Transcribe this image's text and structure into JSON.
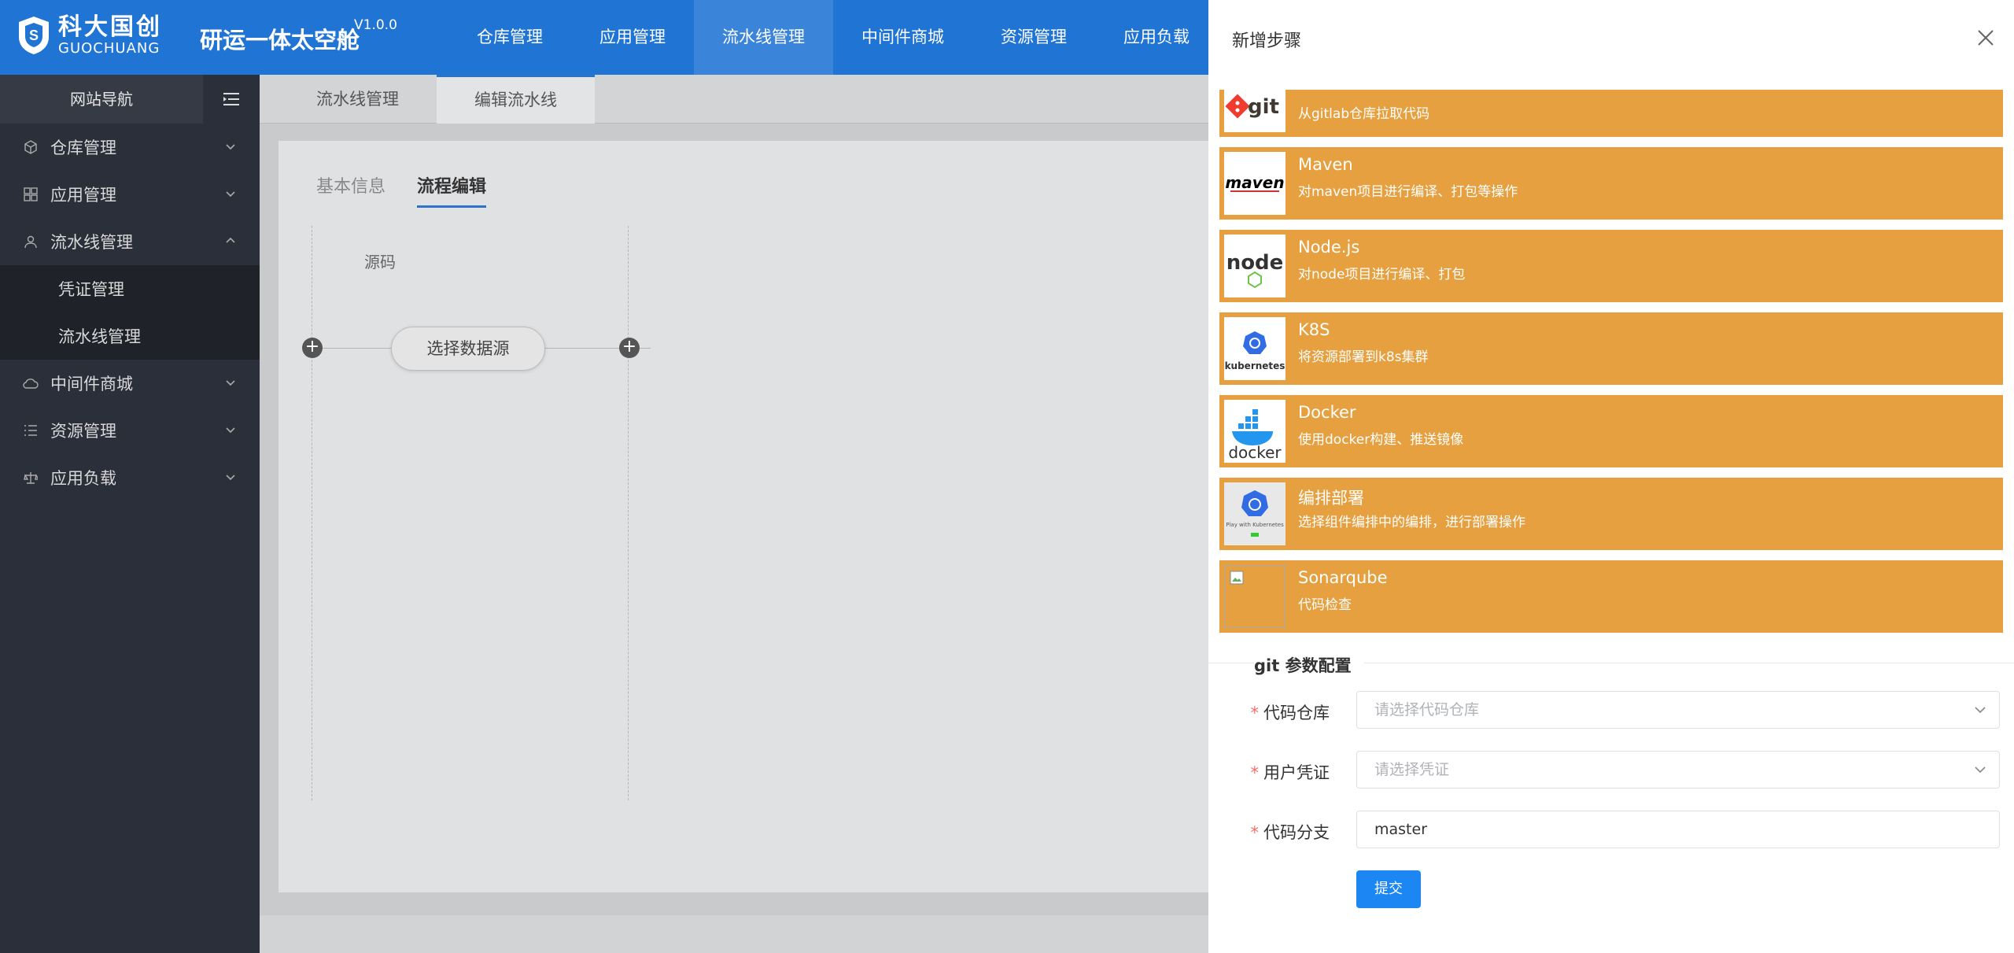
{
  "header": {
    "logo_cn": "科大国创",
    "logo_en": "GUOCHUANG",
    "app_title": "研运一体太空舱",
    "version": "V1.0.0",
    "nav": [
      "仓库管理",
      "应用管理",
      "流水线管理",
      "中间件商城",
      "资源管理",
      "应用负载"
    ],
    "active_nav": "流水线管理"
  },
  "sidebar": {
    "title": "网站导航",
    "items": [
      {
        "label": "仓库管理",
        "icon": "box-icon"
      },
      {
        "label": "应用管理",
        "icon": "grid-icon"
      },
      {
        "label": "流水线管理",
        "icon": "user-group-icon",
        "open": true
      },
      {
        "label": "中间件商城",
        "icon": "cloud-icon"
      },
      {
        "label": "资源管理",
        "icon": "list-icon"
      },
      {
        "label": "应用负载",
        "icon": "balance-icon"
      }
    ],
    "subitems": [
      "凭证管理",
      "流水线管理"
    ]
  },
  "main": {
    "tabs": [
      "流水线管理",
      "编辑流水线"
    ],
    "subtabs": [
      "基本信息",
      "流程编辑"
    ],
    "flow_label": "源码",
    "flow_node": "选择数据源"
  },
  "drawer": {
    "title": "新增步骤",
    "steps": [
      {
        "name": "",
        "desc": "从gitlab仓库拉取代码",
        "logo": "git-logo"
      },
      {
        "name": "Maven",
        "desc": "对maven项目进行编译、打包等操作",
        "logo": "maven-logo"
      },
      {
        "name": "Node.js",
        "desc": "对node项目进行编译、打包",
        "logo": "nodejs-logo"
      },
      {
        "name": "K8S",
        "desc": "将资源部署到k8s集群",
        "logo": "kubernetes-logo"
      },
      {
        "name": "Docker",
        "desc": "使用docker构建、推送镜像",
        "logo": "docker-logo"
      },
      {
        "name": "编排部署",
        "desc": "选择组件编排中的编排，进行部署操作",
        "logo": "play-with-kubernetes-logo"
      },
      {
        "name": "Sonarqube",
        "desc": "代码检查",
        "logo": "broken-image-icon"
      }
    ],
    "logo_text": {
      "git": "git",
      "maven": "maven",
      "node": "node",
      "kubernetes": "kubernetes",
      "docker": "docker",
      "pwk": "Play with Kubernetes"
    },
    "section_title": "git 参数配置",
    "form": {
      "repo_label": "代码仓库",
      "repo_placeholder": "请选择代码仓库",
      "cred_label": "用户凭证",
      "cred_placeholder": "请选择凭证",
      "branch_label": "代码分支",
      "branch_value": "master",
      "submit": "提交"
    }
  },
  "colors": {
    "topbar": "#1f74d4",
    "sidebar": "#2b2f3a",
    "step_bg": "#e6a03f",
    "primary_btn": "#1c86f2"
  }
}
